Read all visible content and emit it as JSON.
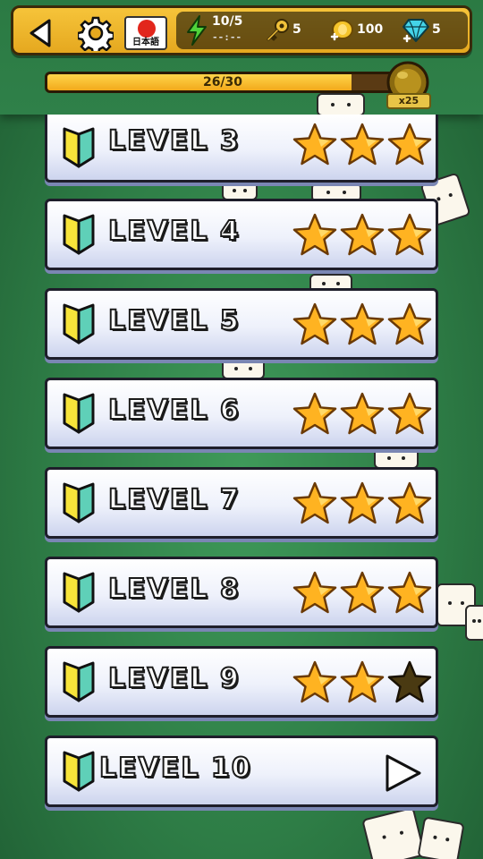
{
  "topbar": {
    "back_icon": "back-arrow-icon",
    "settings_icon": "gear-icon",
    "language_label": "日本語",
    "energy": {
      "icon": "lightning-icon",
      "value": "10/5",
      "timer": "--:--"
    },
    "keys": {
      "icon": "key-icon",
      "value": "5"
    },
    "coins": {
      "icon": "coin-icon",
      "value": "100"
    },
    "gems": {
      "icon": "diamond-icon",
      "value": "5"
    }
  },
  "progress": {
    "label": "26/30",
    "current": 26,
    "max": 30,
    "reward_badge": "x25",
    "reward_icon": "gold-orb-icon"
  },
  "levels": [
    {
      "label": "LEVEL 3",
      "stars": 3
    },
    {
      "label": "LEVEL 4",
      "stars": 3
    },
    {
      "label": "LEVEL 5",
      "stars": 3
    },
    {
      "label": "LEVEL 6",
      "stars": 3
    },
    {
      "label": "LEVEL 7",
      "stars": 3
    },
    {
      "label": "LEVEL 8",
      "stars": 3
    },
    {
      "label": "LEVEL 9",
      "stars": 2
    },
    {
      "label": "LEVEL 10",
      "stars": null,
      "action_icon": "play-triangle-icon"
    }
  ],
  "colors": {
    "background": "#2e7d46",
    "topbar": "#f0b82c",
    "star_gold": "#ffb321",
    "star_empty": "#4a3a12",
    "beginner_green": "#5fd0b8",
    "beginner_yellow": "#f7e43a"
  }
}
